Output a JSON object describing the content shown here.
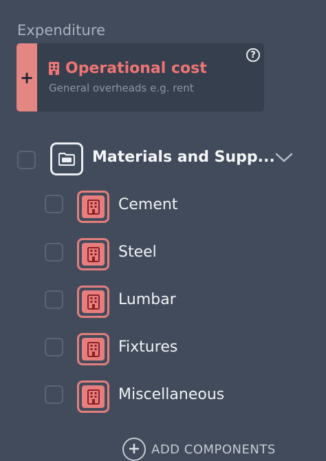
{
  "expenditure": {
    "section_title": "Expenditure",
    "card": {
      "add_glyph": "+",
      "title": "Operational cost",
      "subtitle": "General overheads e.g. rent",
      "help_glyph": "?",
      "accent_color": "#ef7575"
    }
  },
  "group": {
    "label": "Materials and Supp...",
    "icon": "folder-icon",
    "expanded": true,
    "checked": false
  },
  "items": [
    {
      "label": "Cement",
      "icon": "building-icon",
      "checked": false
    },
    {
      "label": "Steel",
      "icon": "building-icon",
      "checked": false
    },
    {
      "label": "Lumbar",
      "icon": "building-icon",
      "checked": false
    },
    {
      "label": "Fixtures",
      "icon": "building-icon",
      "checked": false
    },
    {
      "label": "Miscellaneous",
      "icon": "building-icon",
      "checked": false
    }
  ],
  "add_components": {
    "glyph": "+",
    "label": "ADD COMPONENTS"
  }
}
